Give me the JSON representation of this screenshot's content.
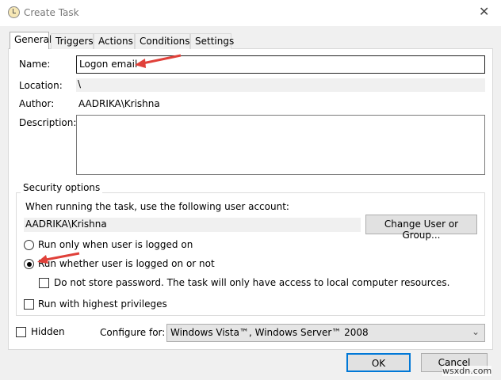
{
  "window": {
    "title": "Create Task",
    "close": "✕"
  },
  "tabs": [
    "General",
    "Triggers",
    "Actions",
    "Conditions",
    "Settings"
  ],
  "general": {
    "name_label": "Name:",
    "name_value": "Logon email",
    "location_label": "Location:",
    "location_value": "\\",
    "author_label": "Author:",
    "author_value": "AADRIKA\\Krishna",
    "description_label": "Description:",
    "description_value": ""
  },
  "security": {
    "legend": "Security options",
    "account_prompt": "When running the task, use the following user account:",
    "account_value": "AADRIKA\\Krishna",
    "change_button": "Change User or Group...",
    "radio_logged_on": "Run only when user is logged on",
    "radio_whether": "Run whether user is logged on or not",
    "radio_selected": "radio_whether",
    "no_store_password": "Do not store password.  The task will only have access to local computer resources.",
    "highest_privileges": "Run with highest privileges"
  },
  "hidden_label": "Hidden",
  "configure_label": "Configure for:",
  "configure_value": "Windows Vista™, Windows Server™ 2008",
  "ok": "OK",
  "cancel": "Cancel",
  "watermark": "wsxdn.com",
  "colors": {
    "annotation_arrow": "#e0413a",
    "focus_border": "#0078d7"
  }
}
